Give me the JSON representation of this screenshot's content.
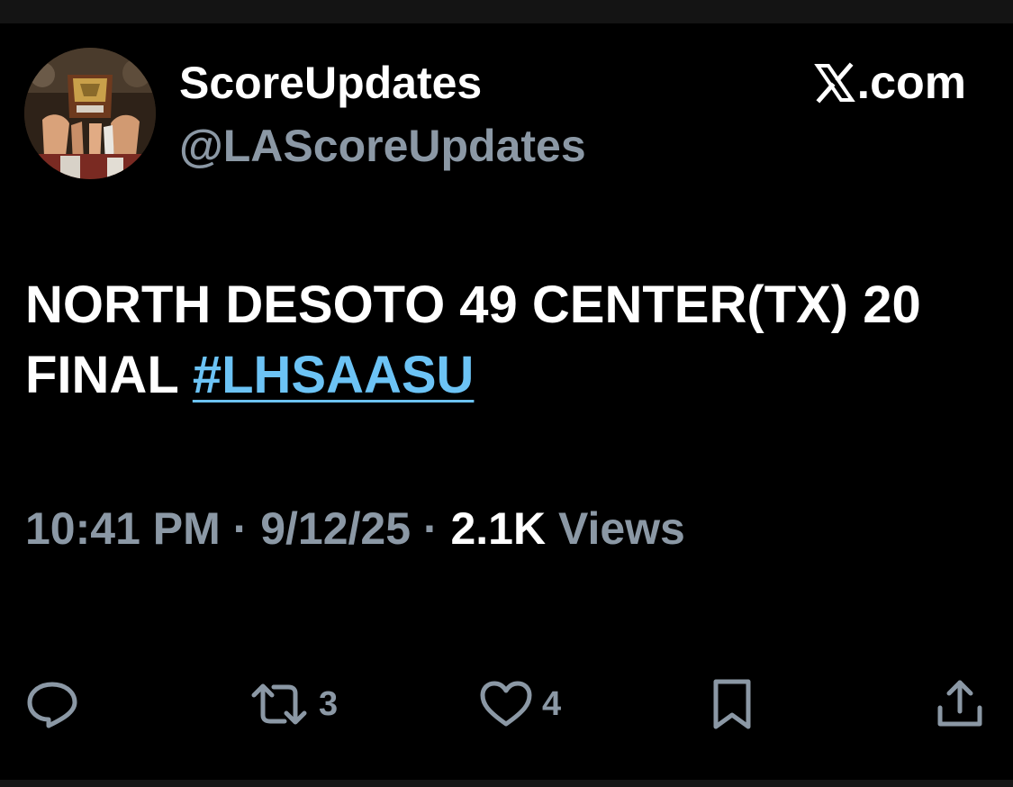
{
  "author": {
    "display_name": "ScoreUpdates",
    "handle": "@LAScoreUpdates",
    "avatar_icon": "trophy-avatar-icon"
  },
  "source": {
    "label": ".com",
    "logo_icon": "x-logo-icon"
  },
  "tweet": {
    "text_line": "NORTH DESOTO 49 CENTER(TX) 20 FINAL ",
    "hashtag": "#LHSAASU"
  },
  "meta": {
    "time": "10:41 PM",
    "separator": " · ",
    "date": "9/12/25",
    "views_count": "2.1K",
    "views_label": " Views"
  },
  "actions": {
    "reply": {
      "icon": "reply-icon"
    },
    "repost": {
      "icon": "repost-icon",
      "count": "3"
    },
    "like": {
      "icon": "heart-icon",
      "count": "4"
    },
    "bookmark": {
      "icon": "bookmark-icon"
    },
    "share": {
      "icon": "share-icon"
    }
  },
  "colors": {
    "background": "#000000",
    "text_primary": "#ffffff",
    "text_secondary": "#8b98a5",
    "link": "#6cc3f5"
  }
}
